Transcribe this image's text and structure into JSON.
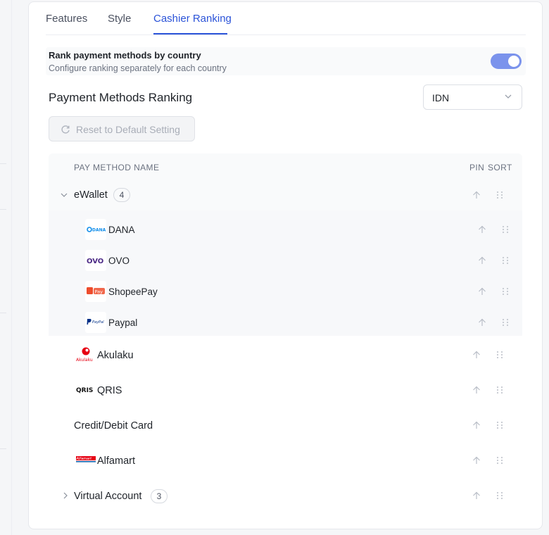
{
  "tabs": [
    {
      "label": "Features",
      "active": false
    },
    {
      "label": "Style",
      "active": false
    },
    {
      "label": "Cashier Ranking",
      "active": true
    }
  ],
  "setting": {
    "title": "Rank payment methods by country",
    "description": "Configure ranking separately for each country",
    "enabled": true
  },
  "ranking": {
    "title": "Payment Methods Ranking",
    "country": "IDN",
    "reset_label": "Reset to Default Setting"
  },
  "table": {
    "headers": {
      "name": "PAY METHOD NAME",
      "pin": "PIN",
      "sort": "SORT"
    },
    "ewallet": {
      "name": "eWallet",
      "count": "4",
      "expanded": true
    },
    "ewallet_children": [
      {
        "name": "DANA",
        "icon": "dana-logo-icon",
        "logo_text": "DANA"
      },
      {
        "name": "OVO",
        "icon": "ovo-logo-icon",
        "logo_text": "OVO"
      },
      {
        "name": "ShopeePay",
        "icon": "shopeepay-logo-icon",
        "logo_text": "Pay"
      },
      {
        "name": "Paypal",
        "icon": "paypal-logo-icon",
        "logo_text": "PayPal"
      }
    ],
    "akulaku": {
      "name": "Akulaku",
      "icon": "akulaku-logo-icon",
      "logo_text": "Akulaku"
    },
    "qris": {
      "name": "QRIS",
      "icon": "qris-logo-icon",
      "logo_text": "QRIS"
    },
    "card": {
      "name": "Credit/Debit Card"
    },
    "alfamart": {
      "name": "Alfamart",
      "icon": "alfamart-logo-icon",
      "logo_text": "Alfamart"
    },
    "virtual_account": {
      "name": "Virtual Account",
      "count": "3",
      "expanded": false
    }
  },
  "colors": {
    "accent": "#2b53d8",
    "toggle": "#7b93ec",
    "ovo": "#4c2a86",
    "shopee": "#ee4d2d",
    "akulaku": "#e60012",
    "dana": "#118eea",
    "paypal": "#003087"
  }
}
